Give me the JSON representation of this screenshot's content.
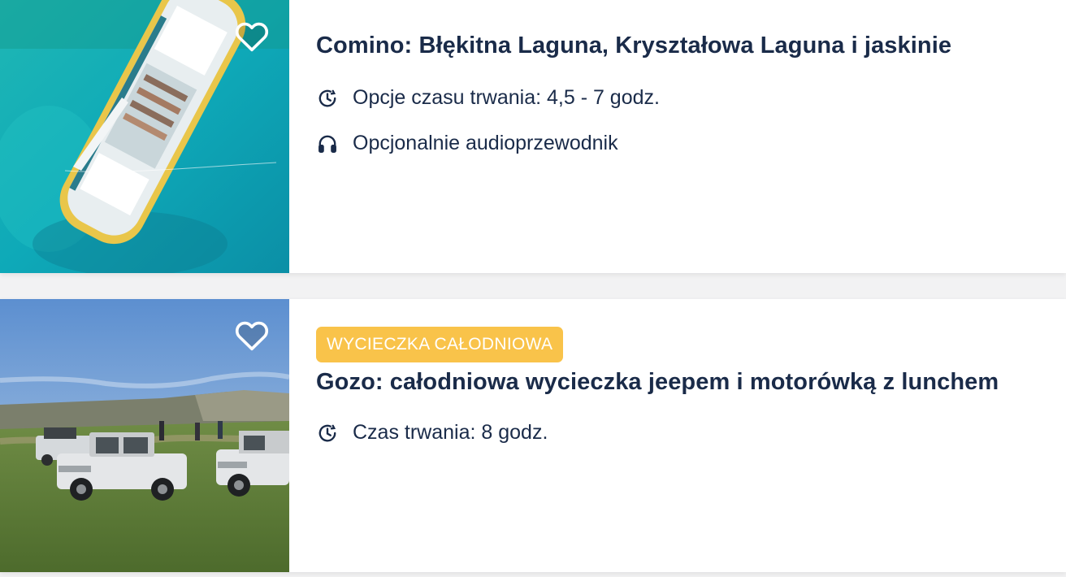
{
  "activities": [
    {
      "title": "Comino: Błękitna Laguna, Kryształowa Laguna i jaskinie",
      "badge": null,
      "features": [
        {
          "icon": "clock-icon",
          "text": "Opcje czasu trwania: 4,5 - 7 godz."
        },
        {
          "icon": "headphones-icon",
          "text": "Opcjonalnie audioprzewodnik"
        }
      ],
      "image": "boat-in-turquoise-lagoon",
      "wishlist_icon": "heart-outline-icon"
    },
    {
      "title": "Gozo: całodniowa wycieczka jeepem i motorówką z lunchem",
      "badge": "WYCIECZKA CAŁODNIOWA",
      "features": [
        {
          "icon": "clock-icon",
          "text": "Czas trwania: 8 godz."
        }
      ],
      "image": "jeeps-on-cliff-top",
      "wishlist_icon": "heart-outline-icon"
    }
  ],
  "colors": {
    "text": "#1a2b49",
    "badge_bg": "#f9c34a",
    "badge_text": "#ffffff",
    "card_bg": "#ffffff",
    "page_bg": "#f2f2f3"
  }
}
